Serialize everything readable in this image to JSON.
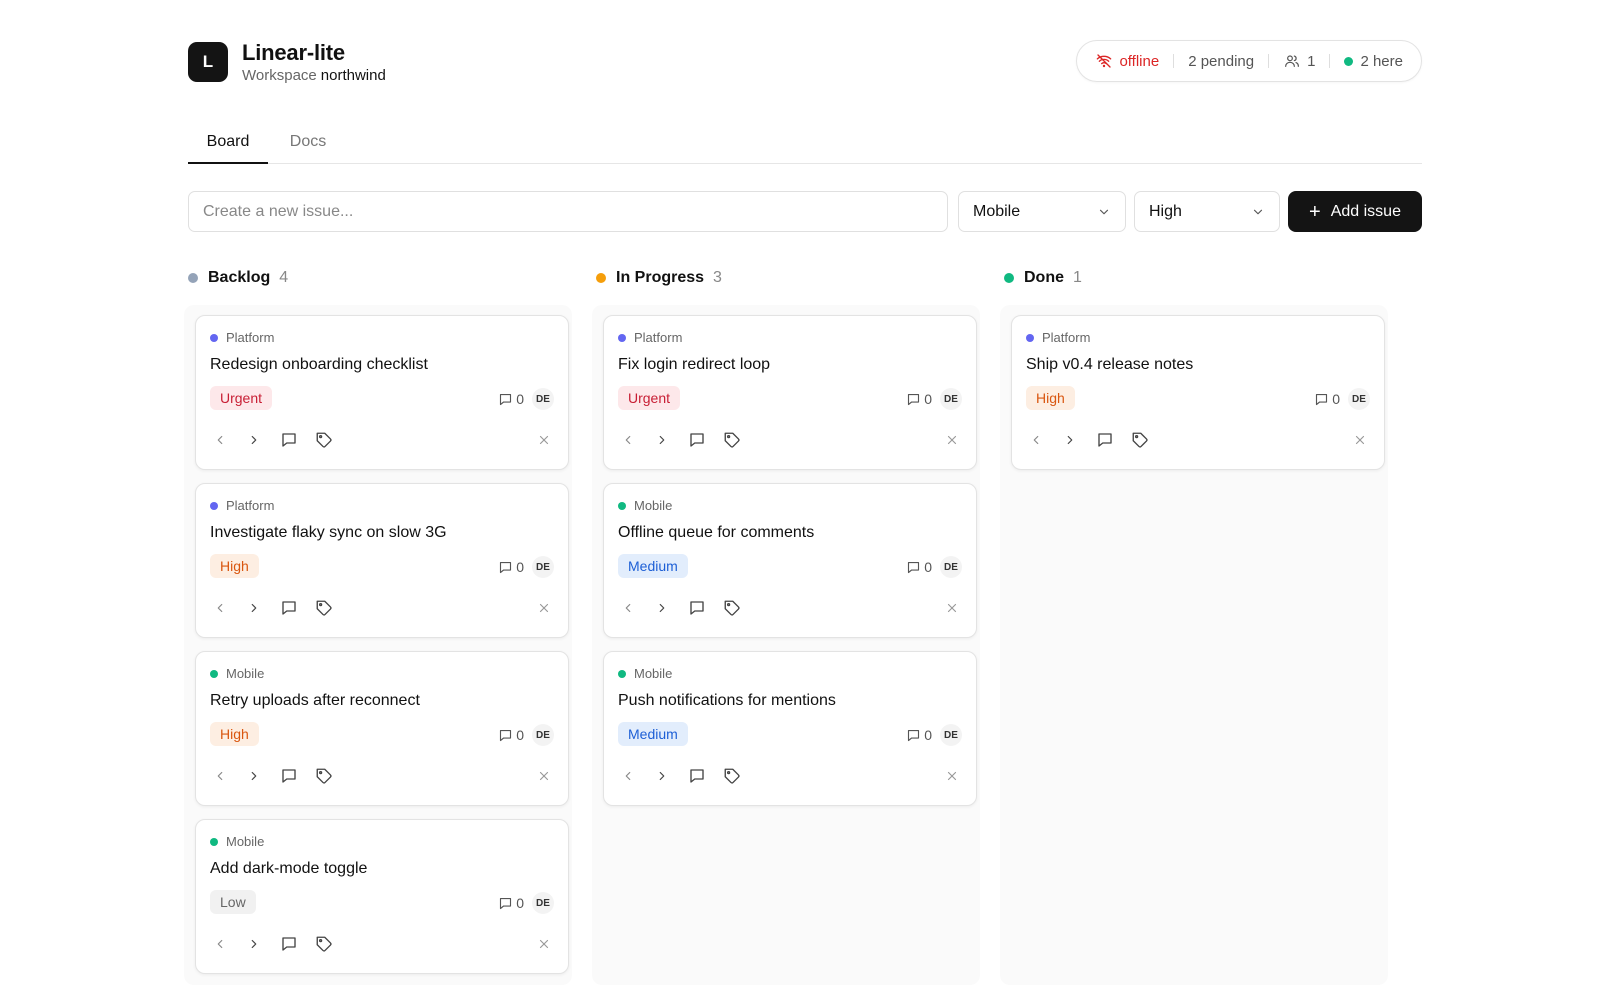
{
  "app": {
    "logo_letter": "L",
    "title": "Linear-lite",
    "workspace_label": "Workspace",
    "workspace_name": "northwind"
  },
  "status": {
    "offline": "offline",
    "pending": "2 pending",
    "users": "1",
    "here": "2 here"
  },
  "tabs": [
    {
      "label": "Board",
      "active": true
    },
    {
      "label": "Docs",
      "active": false
    }
  ],
  "toolbar": {
    "placeholder": "Create a new issue...",
    "team_value": "Mobile",
    "priority_value": "High",
    "add_label": "Add issue"
  },
  "colors": {
    "platform": "#6366f1",
    "mobile": "#10b981",
    "backlog": "#94a3b8",
    "in_progress": "#f59e0b",
    "done": "#10b981"
  },
  "columns": [
    {
      "name": "Backlog",
      "count": "4",
      "cards": [
        {
          "team": "Platform",
          "title": "Redesign onboarding checklist",
          "priority": "Urgent",
          "comments": "0",
          "assignee": "DE"
        },
        {
          "team": "Platform",
          "title": "Investigate flaky sync on slow 3G",
          "priority": "High",
          "comments": "0",
          "assignee": "DE"
        },
        {
          "team": "Mobile",
          "title": "Retry uploads after reconnect",
          "priority": "High",
          "comments": "0",
          "assignee": "DE"
        },
        {
          "team": "Mobile",
          "title": "Add dark-mode toggle",
          "priority": "Low",
          "comments": "0",
          "assignee": "DE"
        }
      ]
    },
    {
      "name": "In Progress",
      "count": "3",
      "cards": [
        {
          "team": "Platform",
          "title": "Fix login redirect loop",
          "priority": "Urgent",
          "comments": "0",
          "assignee": "DE"
        },
        {
          "team": "Mobile",
          "title": "Offline queue for comments",
          "priority": "Medium",
          "comments": "0",
          "assignee": "DE"
        },
        {
          "team": "Mobile",
          "title": "Push notifications for mentions",
          "priority": "Medium",
          "comments": "0",
          "assignee": "DE"
        }
      ]
    },
    {
      "name": "Done",
      "count": "1",
      "cards": [
        {
          "team": "Platform",
          "title": "Ship v0.4 release notes",
          "priority": "High",
          "comments": "0",
          "assignee": "DE"
        }
      ]
    }
  ]
}
